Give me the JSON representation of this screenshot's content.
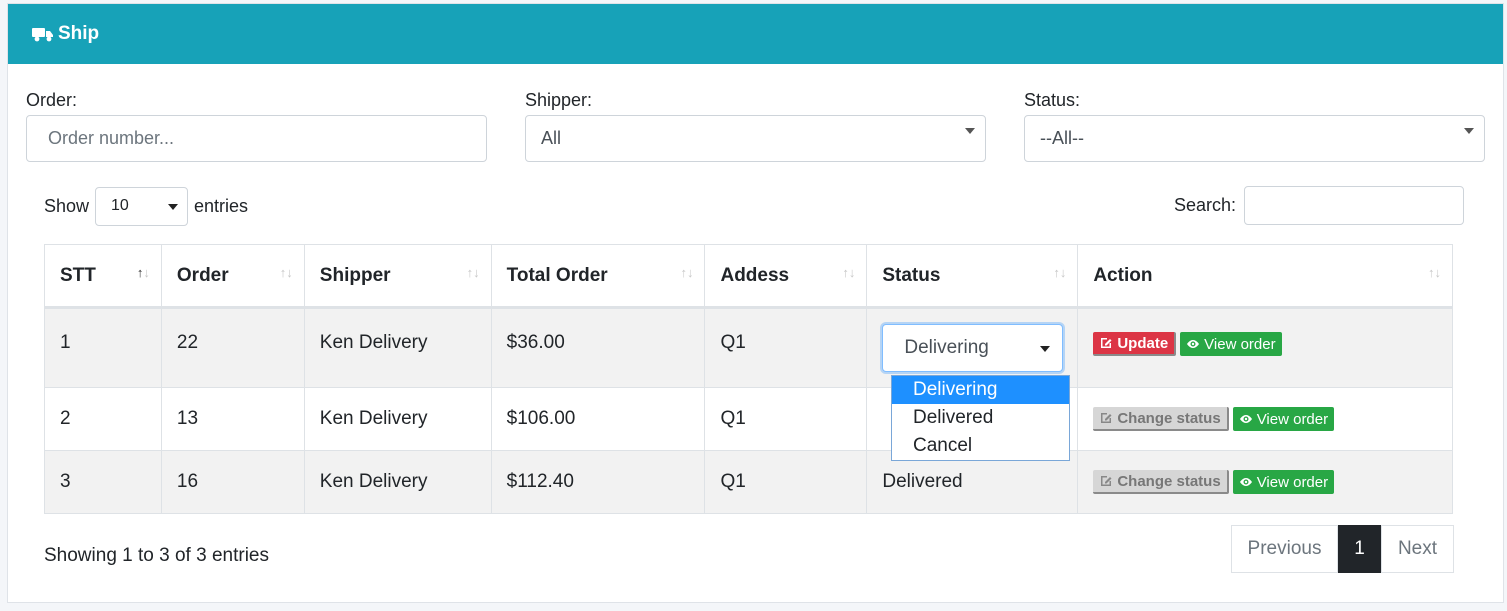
{
  "header": {
    "title": "Ship",
    "icon": "truck-icon"
  },
  "filters": {
    "order_label": "Order:",
    "order_placeholder": "Order number...",
    "shipper_label": "Shipper:",
    "shipper_value": "All",
    "status_label": "Status:",
    "status_value": "--All--"
  },
  "length": {
    "show": "Show",
    "value": "10",
    "entries": "entries"
  },
  "search": {
    "label": "Search:"
  },
  "table": {
    "headers": [
      "STT",
      "Order",
      "Shipper",
      "Total Order",
      "Addess",
      "Status",
      "Action"
    ],
    "rows": [
      {
        "stt": "1",
        "order": "22",
        "shipper": "Ken Delivery",
        "total": "$36.00",
        "address": "Q1",
        "status": "Delivering"
      },
      {
        "stt": "2",
        "order": "13",
        "shipper": "Ken Delivery",
        "total": "$106.00",
        "address": "Q1",
        "status": ""
      },
      {
        "stt": "3",
        "order": "16",
        "shipper": "Ken Delivery",
        "total": "$112.40",
        "address": "Q1",
        "status": "Delivered"
      }
    ]
  },
  "status_options": [
    "Delivering",
    "Delivered",
    "Cancel"
  ],
  "buttons": {
    "update": "Update",
    "view_order": "View order",
    "change_status": "Change status"
  },
  "footer": {
    "info": "Showing 1 to 3 of 3 entries",
    "previous": "Previous",
    "page": "1",
    "next": "Next"
  },
  "colors": {
    "header": "#17a2b8",
    "danger": "#dc3545",
    "success": "#28a745",
    "selected": "#1e90ff"
  }
}
